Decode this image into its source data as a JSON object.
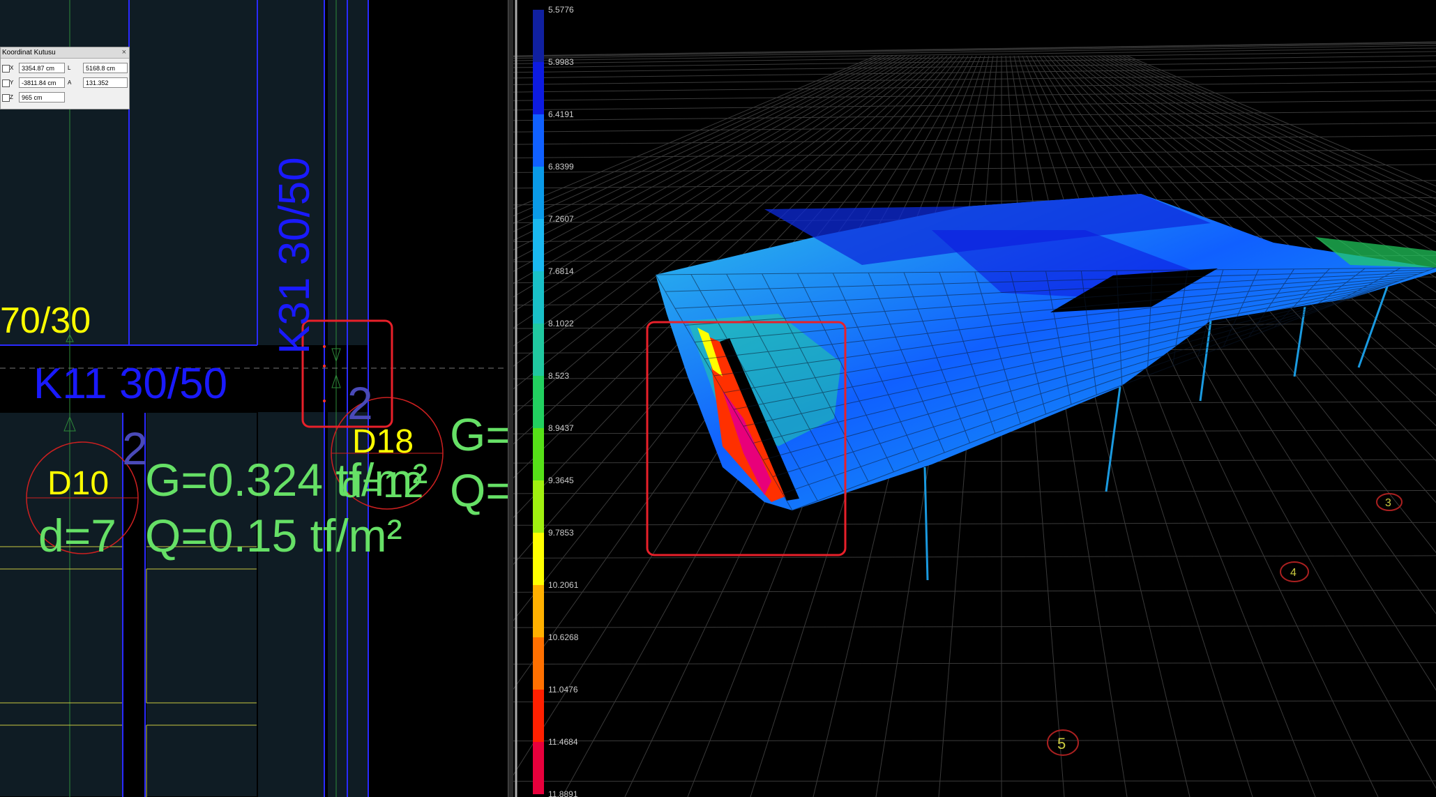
{
  "coord_box": {
    "title": "Koordinat Kutusu",
    "x_label": "X",
    "x_value": "3354.87 cm",
    "l_label": "L",
    "l_value": "5168.8 cm",
    "y_label": "Y",
    "y_value": "-3811.84 cm",
    "a_label": "A",
    "a_value": "131.352",
    "z_label": "Z",
    "z_value": "965 cm",
    "close": "×"
  },
  "plan": {
    "beam_top_left": "70/30",
    "beam_k11": "K11 30/50",
    "beam_k31": "K31 30/50",
    "num_2_a": "2",
    "num_2_b": "2",
    "slab_d10": "D10",
    "slab_d10_thickness": "d=7",
    "slab_d18": "D18",
    "slab_d18_thickness": "d=12",
    "load_g": "G=0.324 tf/m²",
    "load_q": "Q=0.15 tf/m²",
    "load_g_partial": "G=",
    "load_q_partial": "Q="
  },
  "legend": {
    "values": [
      "5.5776",
      "5.9983",
      "6.4191",
      "6.8399",
      "7.2607",
      "7.6814",
      "8.1022",
      "8.523",
      "8.9437",
      "9.3645",
      "9.7853",
      "10.2061",
      "10.6268",
      "11.0476",
      "11.4684",
      "11.8891"
    ],
    "colors": [
      "#1020a0",
      "#0d1be0",
      "#1060ff",
      "#0a9ae8",
      "#1ab8f0",
      "#19c0c8",
      "#20c8a0",
      "#22d060",
      "#56e018",
      "#a0f010",
      "#ffff00",
      "#ffb000",
      "#ff7000",
      "#ff2000",
      "#e8003c",
      "#e8007a"
    ]
  },
  "axis_markers": [
    "3",
    "4",
    "5"
  ]
}
